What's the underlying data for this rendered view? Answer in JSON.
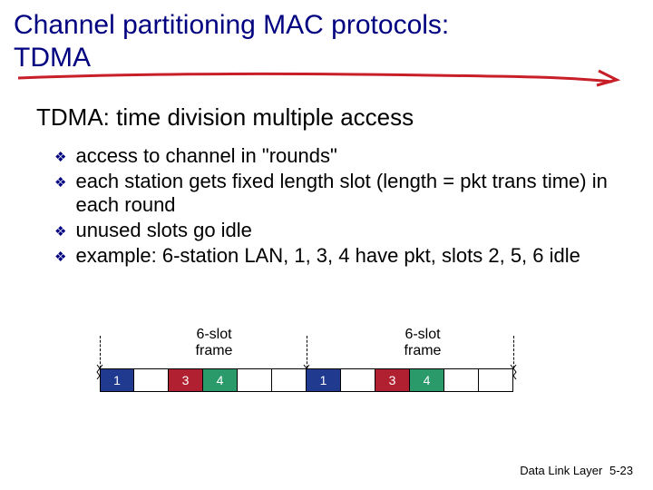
{
  "title_line1": "Channel partitioning MAC protocols:",
  "title_line2": "TDMA",
  "subtitle": "TDMA: time division multiple access",
  "bullets": [
    "access to channel in \"rounds\"",
    "each station gets fixed length slot (length = pkt trans time) in each round",
    "unused slots go idle",
    "example: 6-station LAN, 1, 3, 4 have pkt, slots 2, 5, 6 idle"
  ],
  "diagram": {
    "frame_label": "6-slot\nframe",
    "slots_frame1": [
      "1",
      "",
      "3",
      "4",
      "",
      ""
    ],
    "slots_frame2": [
      "1",
      "",
      "3",
      "4",
      "",
      ""
    ],
    "colors": {
      "slot1": "#203a8f",
      "slot3": "#b02030",
      "slot4": "#2a9a6a"
    }
  },
  "footer": {
    "label": "Data Link Layer",
    "page": "5-23"
  }
}
